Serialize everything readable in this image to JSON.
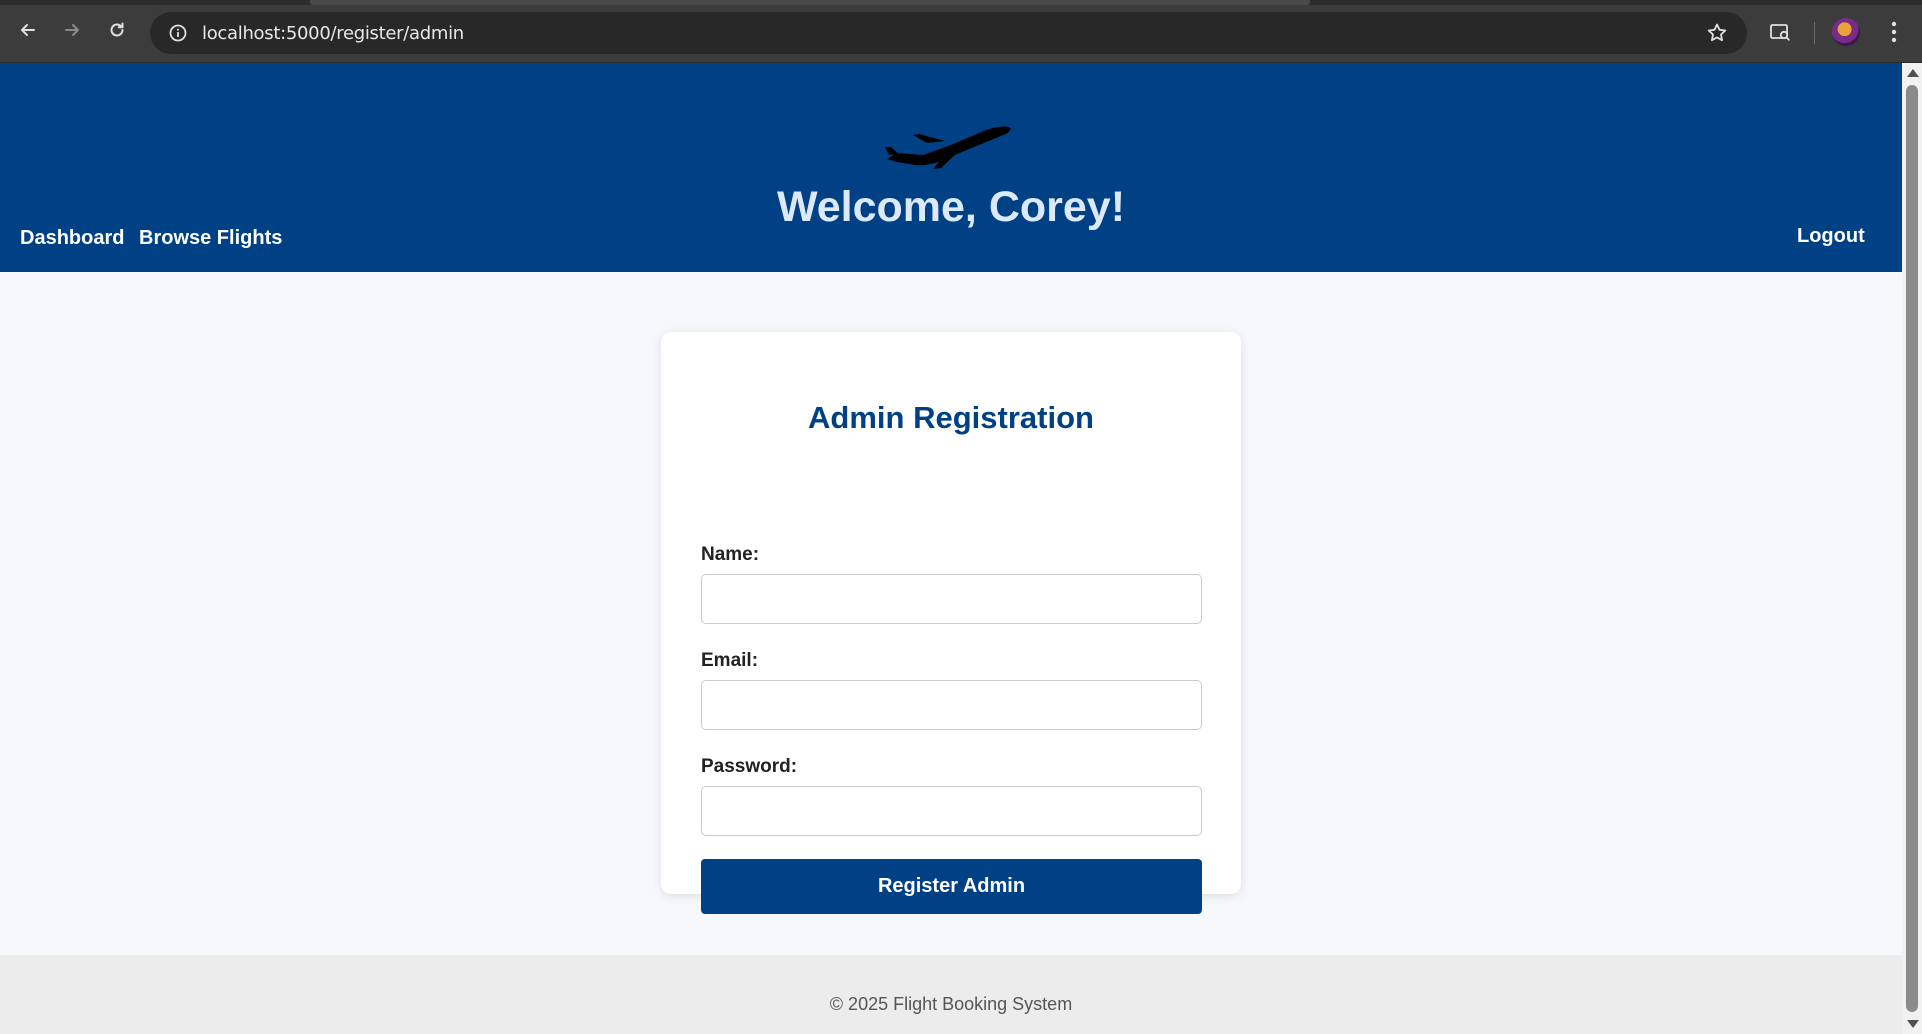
{
  "browser": {
    "url": "localhost:5000/register/admin",
    "icons": [
      "back-arrow-icon",
      "forward-arrow-icon",
      "reload-icon",
      "site-info-icon",
      "bookmark-star-icon",
      "reading-mode-icon",
      "profile-avatar",
      "menu-kebab-icon"
    ]
  },
  "header": {
    "logo": "airplane-icon",
    "welcome": "Welcome, Corey!",
    "nav": {
      "dashboard": "Dashboard",
      "browse_flights": "Browse Flights",
      "logout": "Logout"
    },
    "colors": {
      "background": "#004085",
      "welcome_text": "#dce9f8"
    }
  },
  "form": {
    "title": "Admin Registration",
    "name_label": "Name:",
    "name_value": "",
    "email_label": "Email:",
    "email_value": "",
    "password_label": "Password:",
    "password_value": "",
    "submit_label": "Register Admin"
  },
  "footer": {
    "text": "© 2025 Flight Booking System"
  }
}
